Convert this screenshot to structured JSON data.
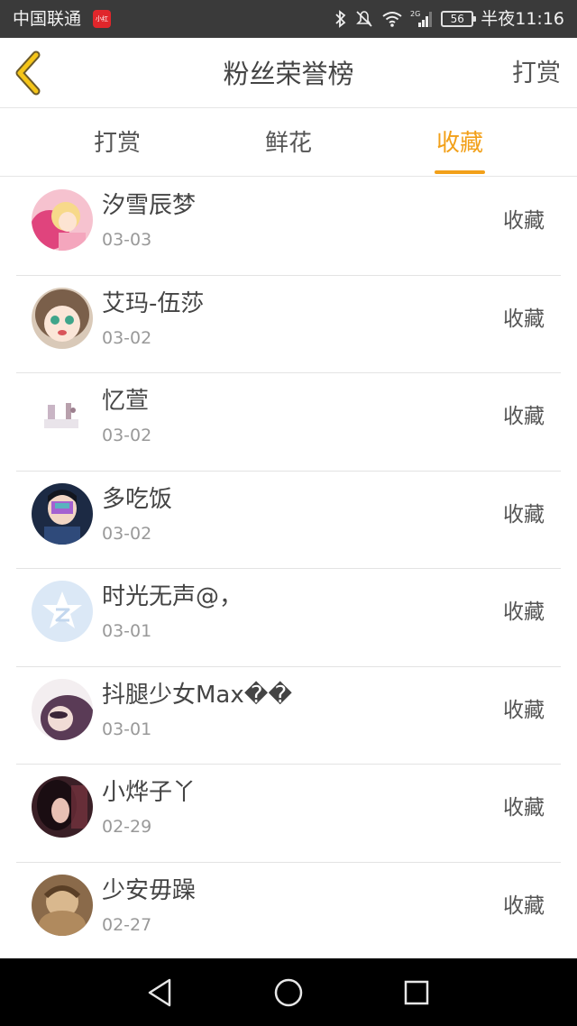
{
  "status_bar": {
    "carrier": "中国联通",
    "carrier_badge": "小红书",
    "network": "2G",
    "battery": "56",
    "time": "半夜11:16"
  },
  "header": {
    "title": "粉丝荣誉榜",
    "action_label": "打赏"
  },
  "tabs": [
    {
      "label": "打赏",
      "active": false
    },
    {
      "label": "鲜花",
      "active": false
    },
    {
      "label": "收藏",
      "active": true
    }
  ],
  "colors": {
    "accent": "#f2a019",
    "status_bar_bg": "#3a3a3a",
    "nav_bar_bg": "#000000"
  },
  "fans": [
    {
      "name": "汐雪辰梦",
      "date": "03-03",
      "action": "收藏"
    },
    {
      "name": "艾玛-伍莎",
      "date": "03-02",
      "action": "收藏"
    },
    {
      "name": "忆萱",
      "date": "03-02",
      "action": "收藏"
    },
    {
      "name": "多吃饭",
      "date": "03-02",
      "action": "收藏"
    },
    {
      "name": "时光无声@，",
      "date": "03-01",
      "action": "收藏"
    },
    {
      "name": "抖腿少女Max��",
      "date": "03-01",
      "action": "收藏"
    },
    {
      "name": "小烨子丫",
      "date": "02-29",
      "action": "收藏"
    },
    {
      "name": "少安毋躁",
      "date": "02-27",
      "action": "收藏"
    }
  ],
  "nav_bar": {
    "icons": [
      "back-triangle-icon",
      "home-circle-icon",
      "recents-square-icon"
    ]
  }
}
